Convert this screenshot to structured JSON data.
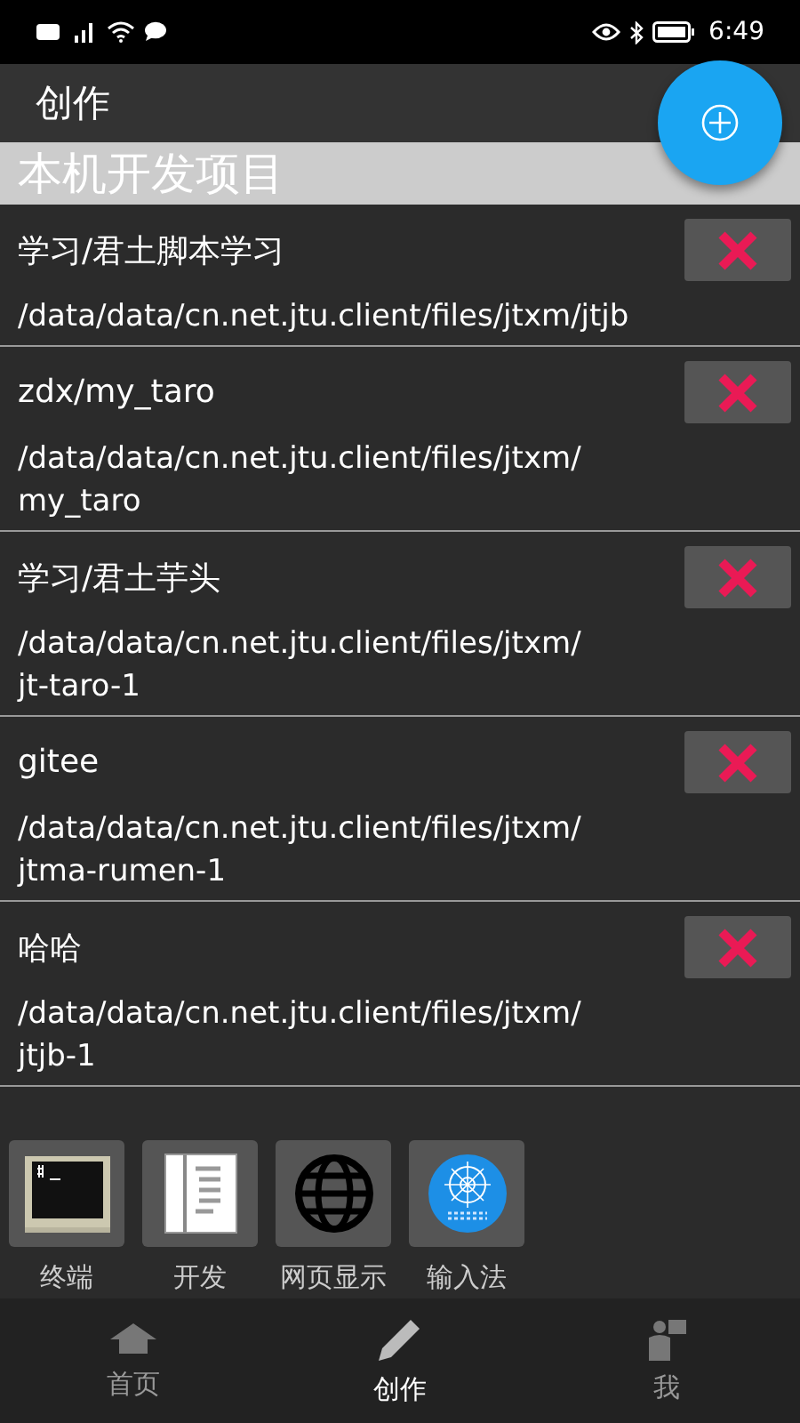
{
  "status_bar": {
    "time": "6:49"
  },
  "header": {
    "title": "创作"
  },
  "section": {
    "title": "本机开发项目"
  },
  "projects": [
    {
      "name": "学习/君土脚本学习",
      "path_lines": [
        "/data/data/cn.net.jtu.client/files/jtxm/jtjb"
      ]
    },
    {
      "name": "zdx/my_taro",
      "path_lines": [
        "/data/data/cn.net.jtu.client/files/jtxm/",
        "my_taro"
      ]
    },
    {
      "name": "学习/君土芋头",
      "path_lines": [
        "/data/data/cn.net.jtu.client/files/jtxm/",
        "jt-taro-1"
      ]
    },
    {
      "name": "gitee",
      "path_lines": [
        "/data/data/cn.net.jtu.client/files/jtxm/",
        "jtma-rumen-1"
      ]
    },
    {
      "name": "哈哈",
      "path_lines": [
        "/data/data/cn.net.jtu.client/files/jtxm/",
        "jtjb-1"
      ]
    }
  ],
  "tools": [
    {
      "kind": "terminal",
      "label": "终端"
    },
    {
      "kind": "document",
      "label": "开发"
    },
    {
      "kind": "globe",
      "label": "网页显示"
    },
    {
      "kind": "keyboard",
      "label": "输入法"
    }
  ],
  "nav": [
    {
      "kind": "home",
      "label": "首页",
      "selected": false
    },
    {
      "kind": "pencil",
      "label": "创作",
      "selected": true
    },
    {
      "kind": "person",
      "label": "我",
      "selected": false
    }
  ]
}
